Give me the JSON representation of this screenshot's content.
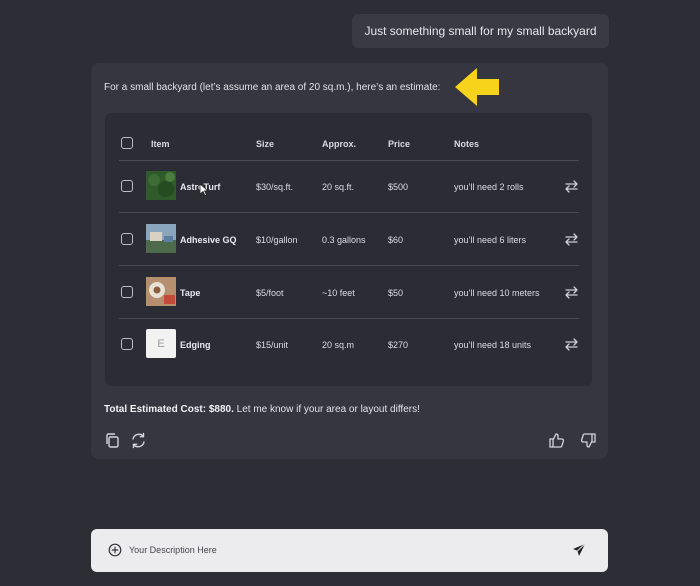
{
  "user_message": "Just something small for my small backyard",
  "assistant": {
    "intro": "For a small backyard (let’s assume an area of 20 sq.m.), here’s an estimate:",
    "table": {
      "headers": {
        "item": "Item",
        "size": "Size",
        "approx": "Approx.",
        "price": "Price",
        "notes": "Notes"
      },
      "rows": [
        {
          "item": "AstroTurf",
          "size": "$30/sq.ft.",
          "approx": "20 sq.ft.",
          "price": "$500",
          "notes": "you’ll need 2 rolls",
          "thumb_color": "#2f5a2a"
        },
        {
          "item": "Adhesive GQ",
          "size": "$10/gallon",
          "approx": "0.3 gallons",
          "price": "$60",
          "notes": "you’ll need 6 liters",
          "thumb_color": "#6a8aa6"
        },
        {
          "item": "Tape",
          "size": "$5/foot",
          "approx": "~10 feet",
          "price": "$50",
          "notes": "you’ll need 10 meters",
          "thumb_color": "#a07a5a"
        },
        {
          "item": "Edging",
          "size": "$15/unit",
          "approx": "20 sq.m",
          "price": "$270",
          "notes": "you’ll need 18 units",
          "thumb_letter": "E",
          "thumb_color": "#f2f2f2"
        }
      ]
    },
    "total_label": "Total Estimated Cost: $880.",
    "total_suffix": " Let me know if your area or layout differs!"
  },
  "input": {
    "placeholder": "Your Description Here"
  },
  "colors": {
    "accent_arrow": "#f7d31b",
    "background": "#2d2d36",
    "card": "#363640"
  },
  "icons": [
    "arrow-pointer-icon",
    "swap-icon",
    "copy-icon",
    "regenerate-icon",
    "thumbs-up-icon",
    "thumbs-down-icon",
    "plus-circle-icon",
    "send-icon"
  ]
}
